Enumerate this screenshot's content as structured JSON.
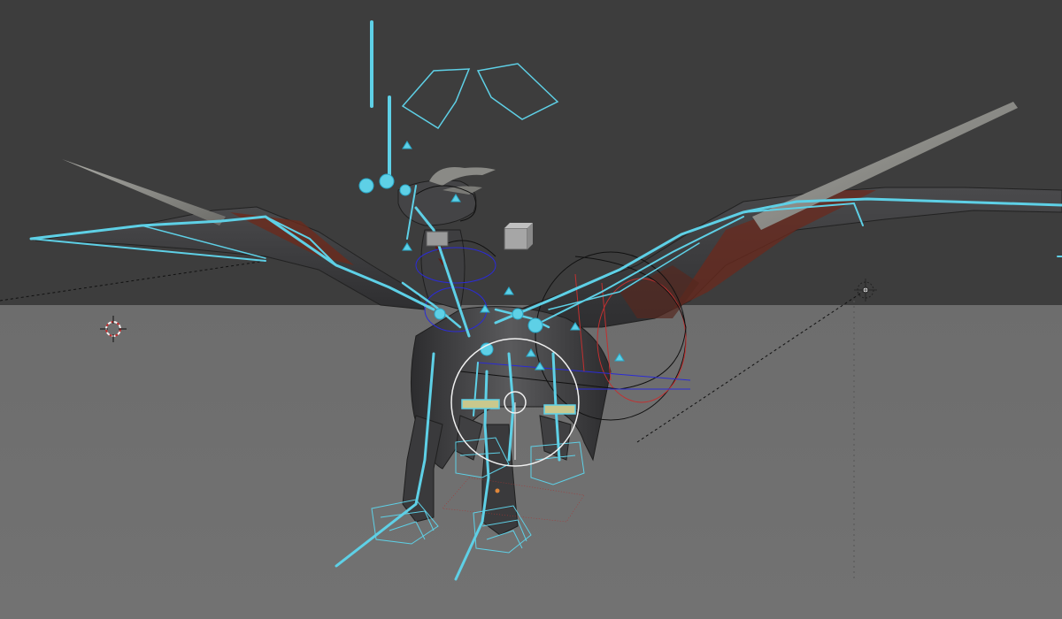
{
  "viewport": {
    "type": "3d-viewport",
    "subject": "dragon-armature-rig",
    "colors": {
      "background": "#3d3d3d",
      "floor": "#6f6f6f",
      "horizon": "#4a4a4a",
      "bone": "#5ed0e6",
      "bone_dark": "#2aa8c8",
      "constraint_blue": "#2b2bd6",
      "constraint_red": "#c23030",
      "mesh_dark": "#3a3a3c",
      "membrane": "#6a2a1e",
      "horn": "#8a8a86",
      "gizmo_black": "#111111",
      "gizmo_white": "#f0f0f0"
    },
    "icons": [
      "3d-cursor-icon",
      "lamp-icon",
      "camera-icon"
    ]
  }
}
